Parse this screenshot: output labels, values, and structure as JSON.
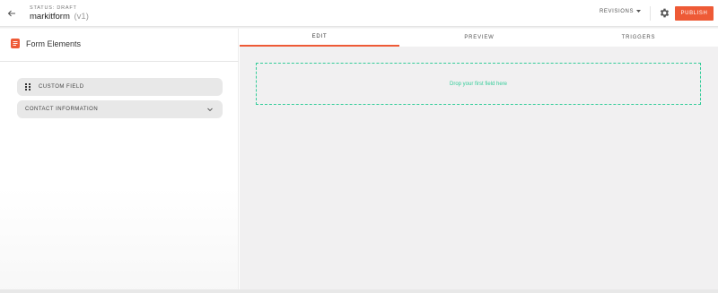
{
  "header": {
    "back_icon": "arrow-left-icon",
    "status": "STATUS: DRAFT",
    "form_name": "markitform",
    "version": "(v1)",
    "revisions_label": "REVISIONS",
    "revisions_icon": "caret-down-icon",
    "settings_icon": "gear-icon",
    "publish_label": "PUBLISH",
    "accent_color": "#ee5a36"
  },
  "sidebar": {
    "title": "Form Elements",
    "title_icon": "form-icon",
    "items": [
      {
        "label": "CUSTOM FIELD",
        "icon": "drag-handle-icon"
      },
      {
        "label": "CONTACT INFORMATION",
        "icon": "chevron-down-icon"
      }
    ]
  },
  "main": {
    "tabs": [
      {
        "label": "EDIT",
        "active": true
      },
      {
        "label": "PREVIEW",
        "active": false
      },
      {
        "label": "TRIGGERS",
        "active": false
      }
    ],
    "dropzone_text": "Drop your first field here",
    "dropzone_color": "#33cc99"
  }
}
